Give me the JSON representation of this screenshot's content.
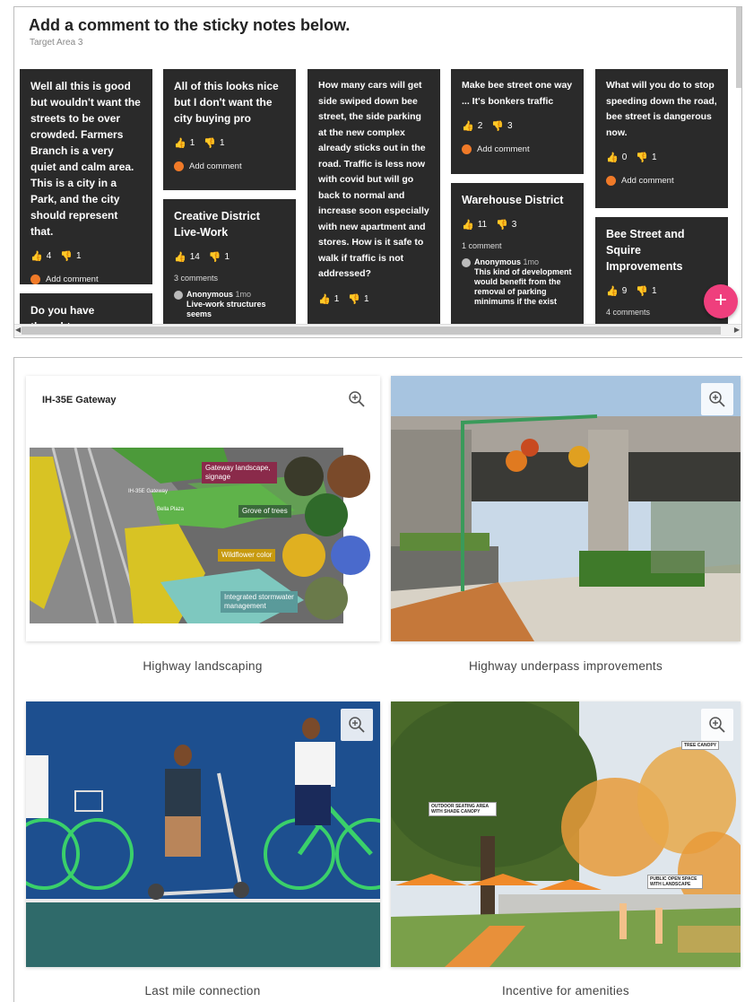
{
  "sticky": {
    "title": "Add a comment to the sticky notes below.",
    "subtitle": "Target Area 3",
    "add_comment_label": "Add comment",
    "fab_label": "+",
    "notes": [
      {
        "text": "Well all this is good but wouldn't want the streets to be over crowded. Farmers Branch is a very quiet and calm area. This is a city in a Park, and the city should represent that.",
        "up": "4",
        "down": "1"
      },
      {
        "text": "Do you have thoughts"
      },
      {
        "text": "All of this looks nice but I don't want the city buying pro",
        "up": "1",
        "down": "1"
      },
      {
        "title": "Creative District Live-Work",
        "up": "14",
        "down": "1",
        "comments": "3 comments",
        "comment_author": "Anonymous",
        "comment_time": "1mo",
        "comment_body": "Live-work structures seems"
      },
      {
        "text": "How many cars will get side swiped down bee street, the side parking at the new complex already sticks out in the road. Traffic is less now with covid but will go back to normal and increase soon especially with new apartment and stores. How is it safe to walk if traffic is not addressed?",
        "up": "1",
        "down": "1"
      },
      {
        "text": "Make bee street one way ... It's bonkers traffic",
        "up": "2",
        "down": "3"
      },
      {
        "title": "Warehouse District",
        "up": "11",
        "down": "3",
        "comments": "1 comment",
        "comment_author": "Anonymous",
        "comment_time": "1mo",
        "comment_body": "This kind of development would benefit from the removal of parking minimums if the exist"
      },
      {
        "text": "What will you do to stop speeding down the road, bee street is dangerous now.",
        "up": "0",
        "down": "1"
      },
      {
        "title": "Bee Street and Squire Improvements",
        "up": "9",
        "down": "1",
        "comments": "4 comments"
      }
    ]
  },
  "gallery": {
    "items": [
      {
        "caption": "Highway landscaping",
        "image_title": "IH-35E Gateway",
        "tags": [
          "Gateway landscape, signage",
          "Grove of trees",
          "Wildflower color",
          "Integrated stormwater management"
        ],
        "map_label_1": "IH-35E Gateway",
        "map_label_2": "Bella Plaza"
      },
      {
        "caption": "Highway underpass improvements"
      },
      {
        "caption": "Last mile connection"
      },
      {
        "caption": "Incentive for amenities",
        "labels": [
          "TREE CANOPY",
          "OUTDOOR SEATING AREA WITH SHADE CANOPY",
          "PUBLIC OPEN SPACE WITH LANDSCAPE"
        ]
      }
    ],
    "zoom_icon": "zoom-in-icon"
  },
  "colors": {
    "note_bg": "#2a2a2a",
    "accent_orange": "#f07a28",
    "fab_pink": "#ef3f7d"
  }
}
